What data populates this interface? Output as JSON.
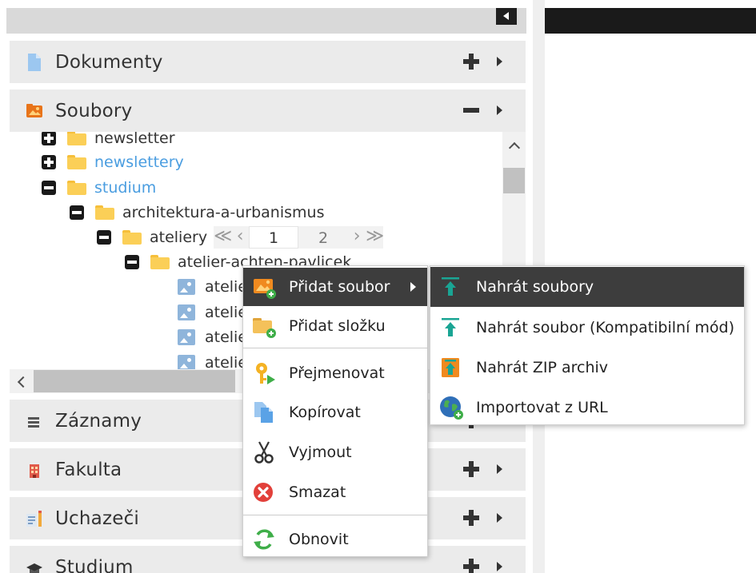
{
  "panels": [
    {
      "title": "Dokumenty",
      "icon": "document-icon",
      "state": "collapsed"
    },
    {
      "title": "Soubory",
      "icon": "image-folder-icon",
      "state": "expanded"
    },
    {
      "title": "Záznamy",
      "icon": "list-icon",
      "state": "collapsed"
    },
    {
      "title": "Fakulta",
      "icon": "building-icon",
      "state": "collapsed"
    },
    {
      "title": "Uchazeči",
      "icon": "applicants-icon",
      "state": "collapsed"
    },
    {
      "title": "Studium",
      "icon": "graduation-cap-icon",
      "state": "collapsed"
    }
  ],
  "tree": {
    "rows": [
      {
        "label": "newsletter",
        "kind": "folder",
        "toggle": "plus",
        "level": 0
      },
      {
        "label": "newslettery",
        "kind": "folder",
        "toggle": "plus",
        "level": 0,
        "link": true
      },
      {
        "label": "studium",
        "kind": "folder",
        "toggle": "minus",
        "level": 0,
        "link": true
      },
      {
        "label": "architektura-a-urbanismus",
        "kind": "folder",
        "toggle": "minus",
        "level": 1
      },
      {
        "label": "ateliery",
        "kind": "folder",
        "toggle": "minus",
        "level": 2
      },
      {
        "label": "atelier-achten-pavlicek",
        "kind": "folder",
        "toggle": "minus",
        "level": 3
      },
      {
        "label": "atelie",
        "kind": "image",
        "level": 4
      },
      {
        "label": "atelie",
        "kind": "image",
        "level": 4
      },
      {
        "label": "atelie",
        "kind": "image",
        "level": 4
      },
      {
        "label": "atelie",
        "kind": "image",
        "level": 4
      }
    ],
    "pager": {
      "first": "≪",
      "prev": "‹",
      "current_page": "1",
      "next_page": "2",
      "next": "›",
      "last": "≫"
    }
  },
  "context_menu": {
    "items": [
      {
        "label": "Přidat soubor",
        "icon": "add-file-icon",
        "has_submenu": true,
        "active": true
      },
      {
        "label": "Přidat složku",
        "icon": "add-folder-icon"
      },
      {
        "label": "Přejmenovat",
        "icon": "rename-key-icon"
      },
      {
        "label": "Kopírovat",
        "icon": "copy-icon"
      },
      {
        "label": "Vyjmout",
        "icon": "cut-scissors-icon"
      },
      {
        "label": "Smazat",
        "icon": "delete-icon"
      },
      {
        "label": "Obnovit",
        "icon": "refresh-icon"
      }
    ]
  },
  "submenu": {
    "items": [
      {
        "label": "Nahrát soubory",
        "icon": "upload-icon",
        "active": true
      },
      {
        "label": "Nahrát soubor (Kompatibilní mód)",
        "icon": "upload-compat-icon"
      },
      {
        "label": "Nahrát ZIP archiv",
        "icon": "upload-zip-icon"
      },
      {
        "label": "Importovat z URL",
        "icon": "import-url-globe-icon"
      }
    ]
  },
  "colors": {
    "panel_header_bg": "#ebebeb",
    "link": "#4a9de0",
    "folder": "#fbcf57",
    "menu_active_bg": "#3d3d3d",
    "upload_teal": "#1aa594"
  }
}
